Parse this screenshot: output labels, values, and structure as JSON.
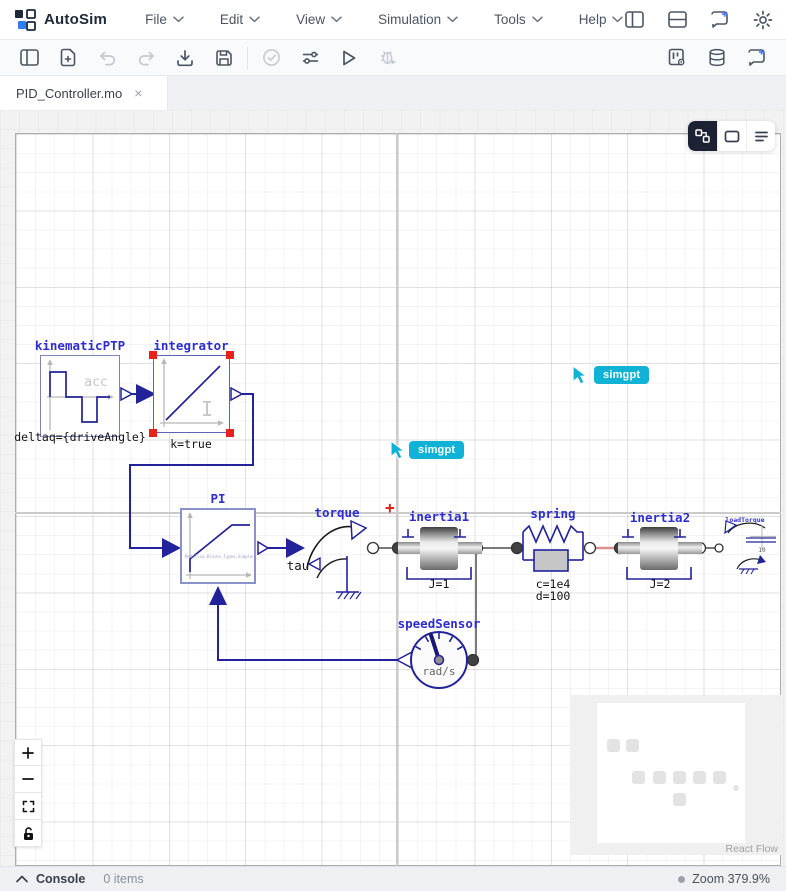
{
  "app": {
    "name": "AutoSim"
  },
  "menubar": {
    "items": [
      "File",
      "Edit",
      "View",
      "Simulation",
      "Tools",
      "Help"
    ],
    "right_icons": [
      "split-columns-icon",
      "split-rows-icon",
      "ai-chat-icon",
      "settings-icon"
    ]
  },
  "toolbar": {
    "left_icons": [
      "panel-left-icon",
      "new-file-icon",
      "undo-icon",
      "redo-icon",
      "import-icon",
      "save-icon",
      "check-circle-icon",
      "tune-icon",
      "run-icon",
      "debug-icon"
    ],
    "right_icons": [
      "board-settings-icon",
      "library-icon",
      "ai-chat-icon"
    ]
  },
  "tab": {
    "label": "PID_Controller.mo",
    "close": "×"
  },
  "canvas": {
    "origin_marker": "+",
    "blocks": {
      "kinematicPTP": {
        "label": "kinematicPTP",
        "icon_text": "acc",
        "param": "deltaq={driveAngle}"
      },
      "integrator": {
        "label": "integrator",
        "icon_text": "I",
        "param": "k=true"
      },
      "pi": {
        "label": "PI",
        "inner_text": "Modelica.Blocks.Types.SimpleController.PI"
      },
      "torque": {
        "label": "torque",
        "tau_text": "tau"
      },
      "inertia1": {
        "label": "inertia1",
        "param": "J=1"
      },
      "spring": {
        "label": "spring",
        "param_c": "c=1e4",
        "param_d": "d=100"
      },
      "inertia2": {
        "label": "inertia2",
        "param": "J=2"
      },
      "loadTorque": {
        "label": "loadTorque",
        "param": "10"
      },
      "speedSensor": {
        "label": "speedSensor",
        "unit": "rad/s"
      }
    },
    "cursors": [
      {
        "label": "simgpt"
      },
      {
        "label": "simgpt"
      }
    ],
    "attribution": "React Flow",
    "zoom_controls": [
      "zoom-in",
      "zoom-out",
      "fit-view",
      "lock"
    ]
  },
  "statusbar": {
    "console_label": "Console",
    "items_count": "0 items",
    "zoom_text": "Zoom 379.9%"
  },
  "colors": {
    "cursor_accent": "#10b3d6",
    "selection_red": "#e8211d",
    "connection_blue": "#22229a",
    "label_blue": "#2e2ed0",
    "spring_link": "#dd8f8f",
    "toggle_active": "#1c2233"
  }
}
